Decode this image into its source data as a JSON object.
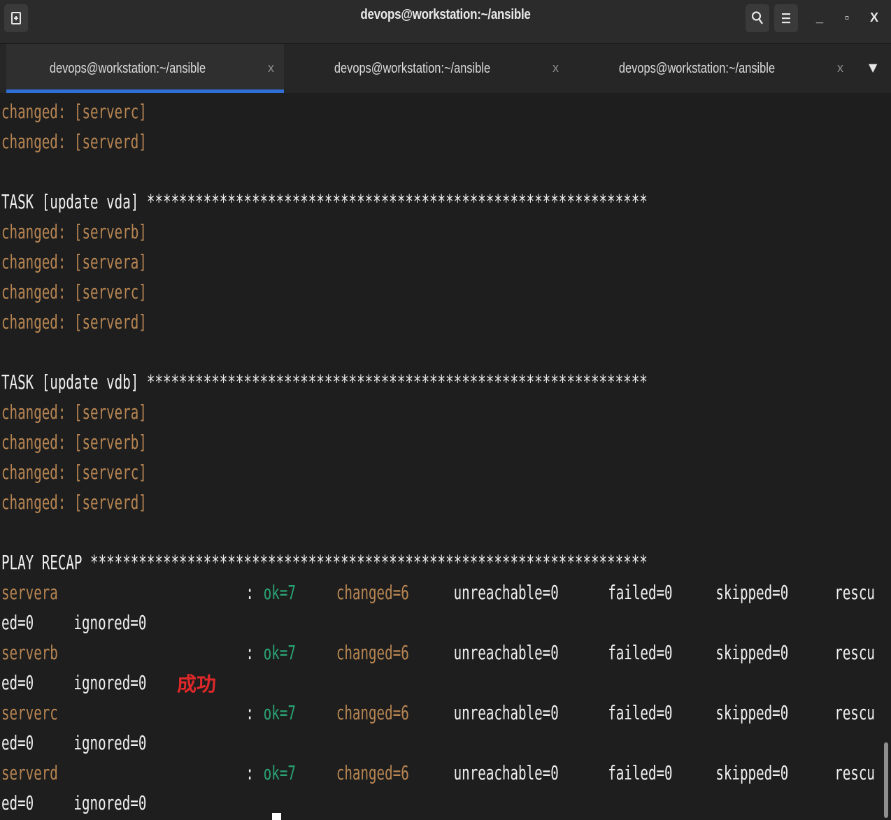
{
  "window": {
    "title": "devops@workstation:~/ansible",
    "minimize_label": "_",
    "maximize_label": "▫",
    "close_label": "X"
  },
  "tabs": [
    {
      "label": "devops@workstation:~/ansible",
      "close": "x",
      "active": true
    },
    {
      "label": "devops@workstation:~/ansible",
      "close": "x",
      "active": false
    },
    {
      "label": "devops@workstation:~/ansible",
      "close": "x",
      "active": false
    }
  ],
  "tab_dropdown": "▼",
  "terminal": {
    "changed_prefix": "changed: ",
    "lines_top": [
      "[serverc]",
      "[serverd]"
    ],
    "task_vda": "TASK [update vda] **************************************************************",
    "vda_hosts": [
      "[serverb]",
      "[servera]",
      "[serverc]",
      "[serverd]"
    ],
    "task_vdb": "TASK [update vdb] **************************************************************",
    "vdb_hosts": [
      "[servera]",
      "[serverb]",
      "[serverc]",
      "[serverd]"
    ],
    "play_recap": "PLAY RECAP *********************************************************************",
    "recap": [
      {
        "host": "servera",
        "sep": ":",
        "ok": "ok=7",
        "changed": "changed=6",
        "unreachable": "unreachable=0",
        "failed": "failed=0",
        "skipped": "skipped=0",
        "rescu": "rescu",
        "cont1": "ed=0",
        "ignored": "ignored=0"
      },
      {
        "host": "serverb",
        "sep": ":",
        "ok": "ok=7",
        "changed": "changed=6",
        "unreachable": "unreachable=0",
        "failed": "failed=0",
        "skipped": "skipped=0",
        "rescu": "rescu",
        "cont1": "ed=0",
        "ignored": "ignored=0"
      },
      {
        "host": "serverc",
        "sep": ":",
        "ok": "ok=7",
        "changed": "changed=6",
        "unreachable": "unreachable=0",
        "failed": "failed=0",
        "skipped": "skipped=0",
        "rescu": "rescu",
        "cont1": "ed=0",
        "ignored": "ignored=0"
      },
      {
        "host": "serverd",
        "sep": ":",
        "ok": "ok=7",
        "changed": "changed=6",
        "unreachable": "unreachable=0",
        "failed": "failed=0",
        "skipped": "skipped=0",
        "rescu": "rescu",
        "cont1": "ed=0",
        "ignored": "ignored=0"
      }
    ],
    "annotation": "成功"
  },
  "colors": {
    "changed": "#b78552",
    "ok": "#2aa374",
    "annotation": "#e0282a",
    "active_tab_indicator": "#2f6fd6"
  },
  "icons": [
    "new-tab-icon",
    "search-icon",
    "hamburger-menu-icon",
    "minimize-icon",
    "maximize-icon",
    "close-icon",
    "tab-close-icon",
    "dropdown-arrow-icon"
  ]
}
